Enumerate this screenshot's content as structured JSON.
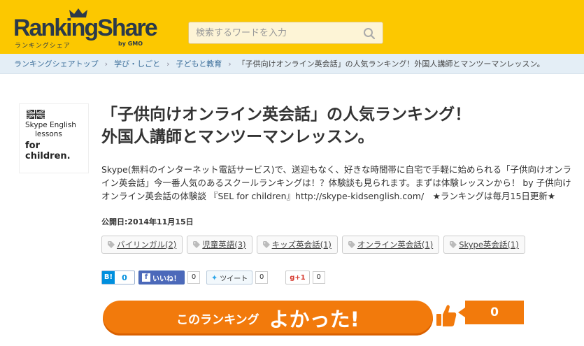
{
  "header": {
    "logo_main": "RankingShare",
    "logo_sub": "ランキングシェア",
    "logo_gmo": "by GMO",
    "search_placeholder": "検索するワードを入力"
  },
  "breadcrumb": [
    {
      "label": "ランキングシェアトップ"
    },
    {
      "label": "学び・しごと"
    },
    {
      "label": "子どもと教育"
    },
    {
      "label": "「子供向けオンライン英会話」の人気ランキング！外国人講師とマンツーマンレッスン。"
    }
  ],
  "thumbnail": {
    "line1": "Skype English",
    "line2": "lessons",
    "line3": "for children."
  },
  "ranking": {
    "title_line1": "「子供向けオンライン英会話」の人気ランキング！",
    "title_line2": "外国人講師とマンツーマンレッスン。",
    "description": "Skype(無料のインターネット電話サービス)で、送迎もなく、好きな時間帯に自宅で手軽に始められる「子供向けオンライン英会話」今一番人気のあるスクールランキングは！？体験談も見られます。まずは体験レッスンから！ by 子供向けオンライン英会話の体験談 『SEL for children』http://skype-kidsenglish.com/　★ランキングは毎月15日更新★",
    "published": "公開日:2014年11月15日"
  },
  "tags": [
    {
      "label": "バイリンガル(2)"
    },
    {
      "label": "児童英語(3)"
    },
    {
      "label": "キッズ英会話(1)"
    },
    {
      "label": "オンライン英会話(1)"
    },
    {
      "label": "Skype英会話(1)"
    }
  ],
  "social": {
    "hatena_label": "B!",
    "hatena_count": "0",
    "fb_label": "いいね！",
    "fb_count": "0",
    "tw_label": "ツイート",
    "tw_count": "0",
    "gp_label": "g+1",
    "gp_count": "0"
  },
  "good": {
    "small": "このランキング",
    "big": "よかった!",
    "count": "0"
  },
  "colors": {
    "header_bg": "#fcc800",
    "accent_orange": "#f27a0c",
    "breadcrumb_bg": "#e4eef6"
  }
}
